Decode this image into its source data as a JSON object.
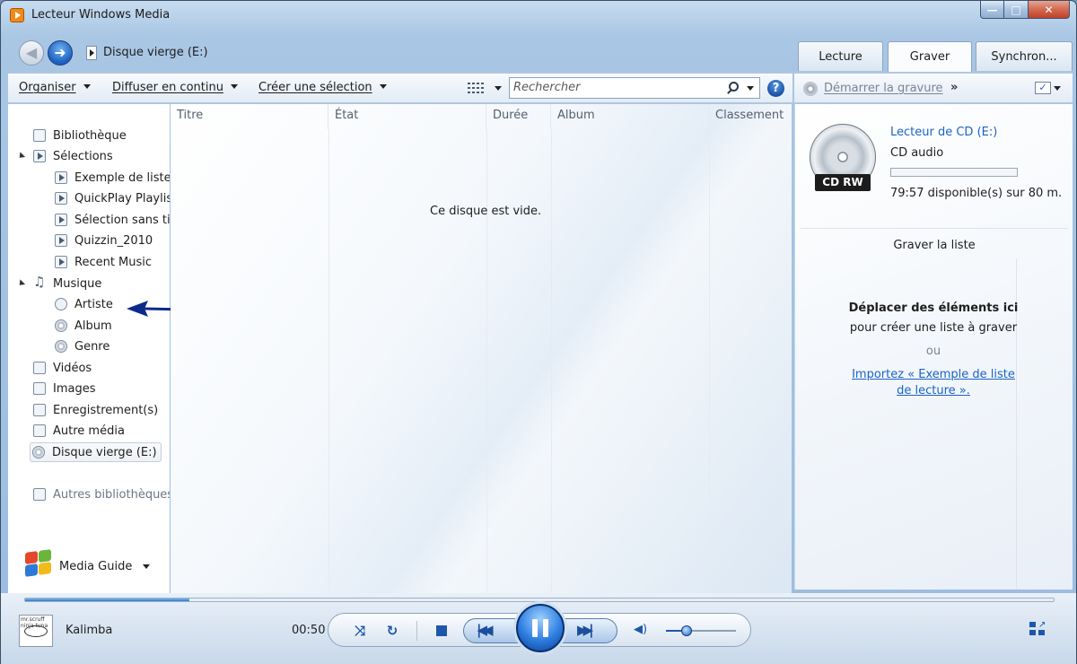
{
  "window": {
    "title": "Lecteur Windows Media",
    "caption": {
      "minimize": "—",
      "maximize": "□",
      "close": "✕"
    }
  },
  "navbar": {
    "back_glyph": "◀",
    "forward_glyph": "➜",
    "breadcrumb": "Disque vierge (E:)"
  },
  "tabs": [
    {
      "label": "Lecture",
      "active": false
    },
    {
      "label": "Graver",
      "active": true
    },
    {
      "label": "Synchron...",
      "active": false
    }
  ],
  "toolbar": {
    "organize": "Organiser",
    "stream": "Diffuser en continu",
    "create_playlist": "Créer une sélection",
    "search_placeholder": "Rechercher",
    "help_glyph": "?"
  },
  "burn_toolbar": {
    "start_burn": "Démarrer la gravure",
    "more": "»",
    "options_glyph": "✓"
  },
  "nav": {
    "library": "Bibliothèque",
    "playlists": "Sélections",
    "playlist_items": [
      "Exemple de liste de lecture",
      "QuickPlay Playlist",
      "Sélection sans titre",
      "Quizzin_2010",
      "Recent Music"
    ],
    "music": "Musique",
    "music_items": [
      "Artiste",
      "Album",
      "Genre"
    ],
    "videos": "Vidéos",
    "images": "Images",
    "recordings": "Enregistrement(s)",
    "other_media": "Autre média",
    "blank_disc": "Disque vierge (E:)",
    "other_libraries": "Autres bibliothèques",
    "media_guide": "Media Guide"
  },
  "columns": [
    "Titre",
    "État",
    "Durée",
    "Album",
    "Classement"
  ],
  "content": {
    "empty_message": "Ce disque est vide."
  },
  "burn_pane": {
    "drive_name": "Lecteur de CD (E:)",
    "disc_type": "CD audio",
    "disc_label": "CD RW",
    "capacity_used_fraction": 0.0,
    "capacity_text": "79:57 disponible(s) sur 80 m...",
    "list_title": "Graver la liste",
    "drop_title": "Déplacer des éléments ici",
    "drop_subtitle": "pour créer une liste à graver",
    "or_text": "ou",
    "import_link": "Importez « Exemple de liste de lecture »."
  },
  "playback": {
    "album_art_text": "mr.scruff ninja tuna",
    "track": "Kalimba",
    "time": "00:50",
    "progress_fraction": 0.16,
    "volume_fraction": 0.3,
    "shuffle_glyph": "⤨",
    "repeat_glyph": "↻",
    "prev_glyph": "|◀◀",
    "next_glyph": "▶▶|",
    "volume_glyph": "◀)"
  },
  "colors": {
    "link": "#1a64c4",
    "accent": "#1d57aa",
    "capacity_fill": "#7fc257"
  }
}
